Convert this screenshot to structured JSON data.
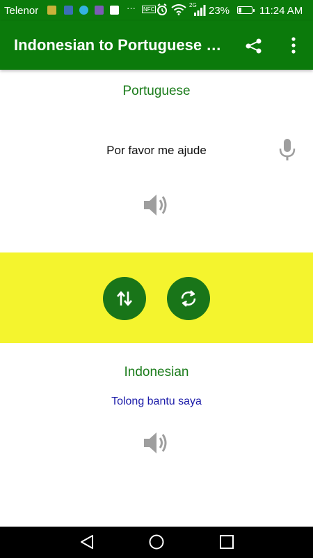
{
  "status_bar": {
    "carrier": "Telenor",
    "more_notifications": "···",
    "nfc": "NFC",
    "network_type": "2G",
    "battery_percent": "23%",
    "battery_level": 0.23,
    "time": "11:24 AM"
  },
  "app_bar": {
    "title": "Indonesian to Portuguese Translator",
    "share_icon": "share-icon",
    "menu_icon": "more-vert-icon"
  },
  "source": {
    "language": "Portuguese",
    "text": "Por favor me ajude",
    "mic_icon": "mic-icon",
    "speaker_icon": "speaker-icon"
  },
  "controls": {
    "swap_icon": "swap-vertical-icon",
    "refresh_icon": "refresh-icon"
  },
  "target": {
    "language": "Indonesian",
    "text": "Tolong bantu saya",
    "speaker_icon": "speaker-icon"
  },
  "nav_bar": {
    "back_icon": "back-triangle-icon",
    "home_icon": "home-circle-icon",
    "recents_icon": "recents-square-icon"
  },
  "colors": {
    "app_bar": "#0b7a0b",
    "label_green": "#1b7c1b",
    "control_band": "#f4f42e",
    "fab": "#197519",
    "translation_text": "#1a1aa8",
    "icon_gray": "#9e9e9e"
  }
}
